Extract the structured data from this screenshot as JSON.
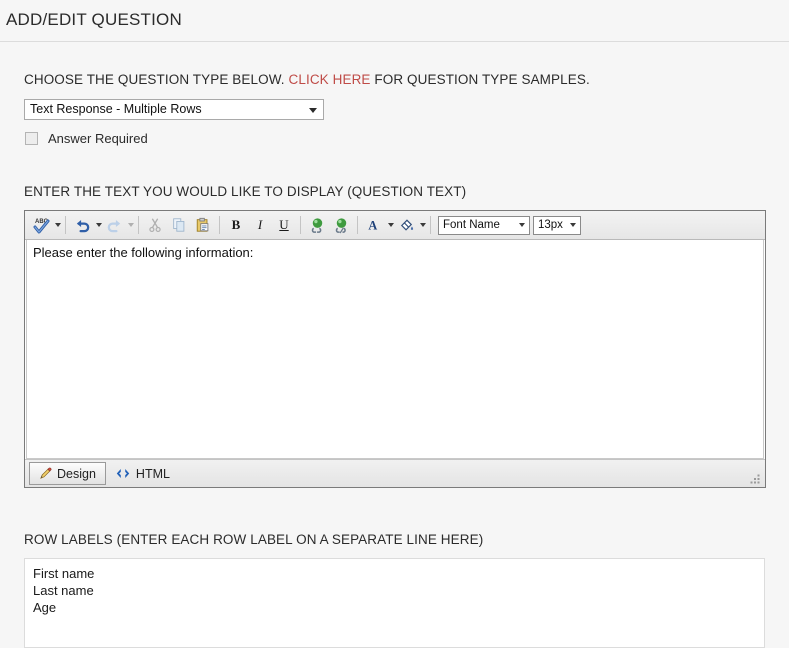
{
  "page": {
    "title": "ADD/EDIT QUESTION"
  },
  "question_type": {
    "label_before_link": "CHOOSE THE QUESTION TYPE BELOW.",
    "link_text": "CLICK HERE",
    "label_after_link": "FOR QUESTION TYPE SAMPLES.",
    "link_color": "#bf4b47",
    "selected_option": "Text Response - Multiple Rows",
    "options": [
      "Text Response - Multiple Rows"
    ],
    "answer_required_label": "Answer Required",
    "answer_required_checked": false
  },
  "question_text": {
    "section_label": "ENTER THE TEXT YOU WOULD LIKE TO DISPLAY (QUESTION TEXT)",
    "toolbar": {
      "spellcheck": "spellcheck-icon",
      "undo": "undo-icon",
      "redo": "redo-icon",
      "cut": "cut-icon",
      "copy": "copy-icon",
      "paste": "paste-icon",
      "bold_label": "B",
      "italic_label": "I",
      "underline_label": "U",
      "insert_link": "insert-hyperlink-icon",
      "remove_link": "remove-hyperlink-icon",
      "font_color_label": "A",
      "highlight_color": "highlight-color-icon",
      "font_name_value": "Font Name",
      "font_size_value": "13px"
    },
    "body_text": "Please enter the following information:",
    "tabs": [
      {
        "label": "Design",
        "icon": "pencil-icon",
        "active": true
      },
      {
        "label": "HTML",
        "icon": "code-brackets-icon",
        "active": false
      }
    ]
  },
  "row_labels": {
    "section_label": "ROW LABELS (ENTER EACH ROW LABEL ON A SEPARATE LINE HERE)",
    "lines": [
      "First name",
      "Last name",
      "Age"
    ],
    "line_0": "First name",
    "line_1": "Last name",
    "line_2": "Age"
  }
}
